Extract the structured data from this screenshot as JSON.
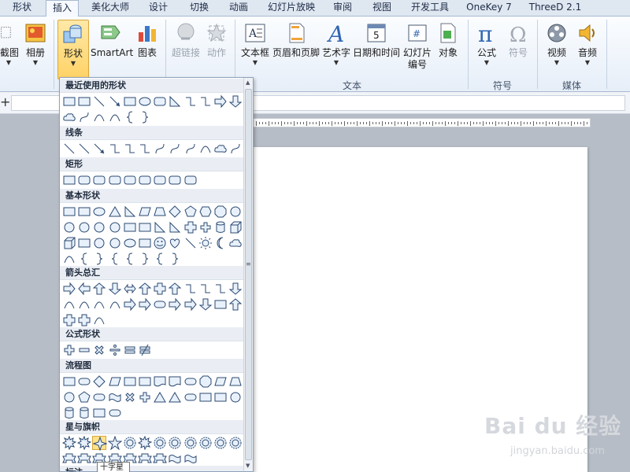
{
  "tabs": [
    {
      "label": "形状"
    },
    {
      "label": "插入"
    },
    {
      "label": "美化大师"
    },
    {
      "label": "设计"
    },
    {
      "label": "切换"
    },
    {
      "label": "动画"
    },
    {
      "label": "幻灯片放映"
    },
    {
      "label": "审阅"
    },
    {
      "label": "视图"
    },
    {
      "label": "开发工具"
    },
    {
      "label": "OneKey 7"
    },
    {
      "label": "ThreeD 2.1"
    }
  ],
  "ribbon": {
    "screenshot": "截图",
    "album": "相册",
    "shapes": "形状",
    "smartart": "SmartArt",
    "chart": "图表",
    "hyperlink": "超链接",
    "action": "动作",
    "textbox": "文本框",
    "header_footer": "页眉和页脚",
    "wordart": "艺术字",
    "datetime": "日期和时间",
    "slide_number": "幻灯片\n编号",
    "object": "对象",
    "equation": "公式",
    "symbol": "符号",
    "video": "视频",
    "audio": "音频",
    "group_text": "文本",
    "group_symbols": "符号",
    "group_media": "媒体"
  },
  "panel": {
    "recent": "最近使用的形状",
    "lines": "线条",
    "rect": "矩形",
    "basic": "基本形状",
    "arrows": "箭头总汇",
    "equation": "公式形状",
    "flowchart": "流程图",
    "stars": "星与旗帜",
    "next": "标注",
    "tooltip": "十字星"
  },
  "watermark": {
    "brand": "Bai du 经验",
    "url": "jingyan.baidu.com"
  }
}
